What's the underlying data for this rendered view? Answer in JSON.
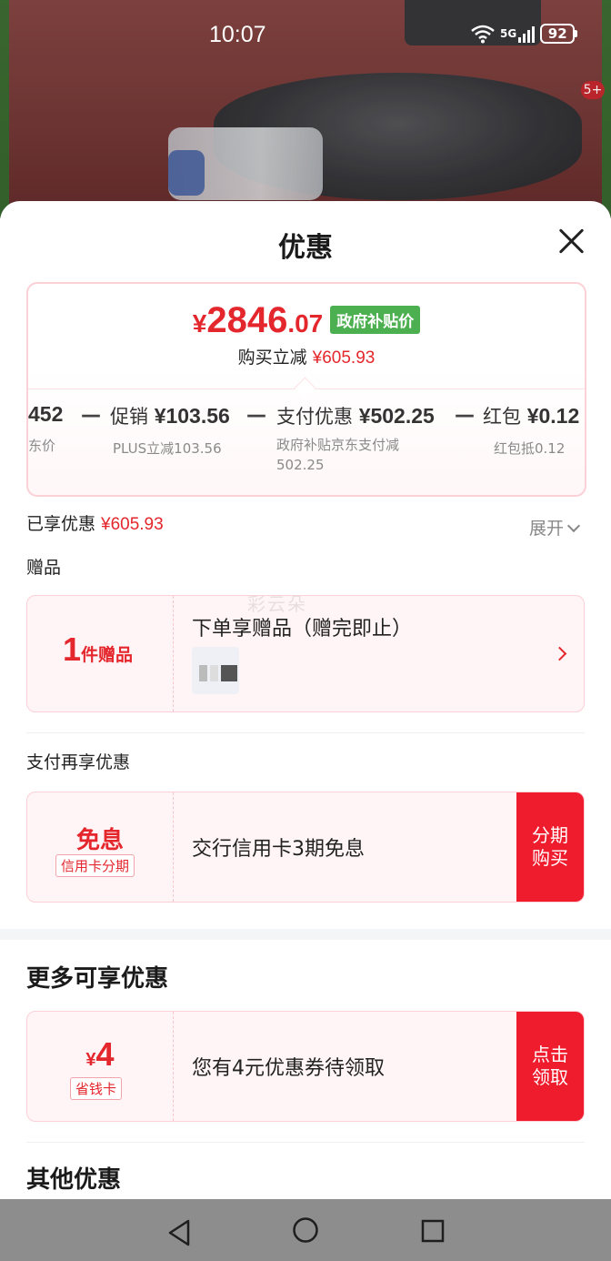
{
  "status_bar": {
    "time": "10:07",
    "network": "5G",
    "battery": "92"
  },
  "background": {
    "cart_badge": "5+"
  },
  "sheet": {
    "title": "优惠",
    "price": {
      "currency": "¥",
      "integer": "2846",
      "decimal": ".07",
      "tag": "政府补贴价"
    },
    "reduce": {
      "label": "购买立减",
      "amount": "¥605.93"
    },
    "breakdown": [
      {
        "main_value": "452",
        "sub": "东价"
      },
      {
        "main_label": "促销",
        "main_value": "¥103.56",
        "sub": "PLUS立减103.56"
      },
      {
        "main_label": "支付优惠",
        "main_value": "¥502.25",
        "sub_line1": "政府补贴京东支付减",
        "sub_line2": "502.25"
      },
      {
        "main_label": "红包",
        "main_value": "¥0.12",
        "sub": "红包抵0.12"
      }
    ],
    "dash": "—",
    "enjoyed": {
      "label": "已享优惠",
      "amount": "¥605.93"
    },
    "expand_label": "展开",
    "gift_section": {
      "label": "赠品",
      "count": "1",
      "count_suffix": "件赠品",
      "title": "下单享赠品（赠完即止）"
    },
    "pay_section": {
      "label": "支付再享优惠",
      "left_title": "免息",
      "left_tag": "信用卡分期",
      "text": "交行信用卡3期免息",
      "button_line1": "分期",
      "button_line2": "购买"
    },
    "more_section": {
      "title": "更多可享优惠",
      "currency": "¥",
      "amount": "4",
      "tag": "省钱卡",
      "text": "您有4元优惠券待领取",
      "button_line1": "点击",
      "button_line2": "领取"
    },
    "other_title": "其他优惠",
    "watermark": "彩云朵"
  },
  "colors": {
    "accent_red": "#e4262d",
    "button_red": "#ef1c2e",
    "gov_green": "#4caf50"
  },
  "icons": [
    "wifi-icon",
    "signal-icon",
    "battery-icon",
    "close-icon",
    "chevron-down-icon",
    "chevron-right-icon",
    "nav-back-icon",
    "nav-home-icon",
    "nav-recent-icon"
  ]
}
